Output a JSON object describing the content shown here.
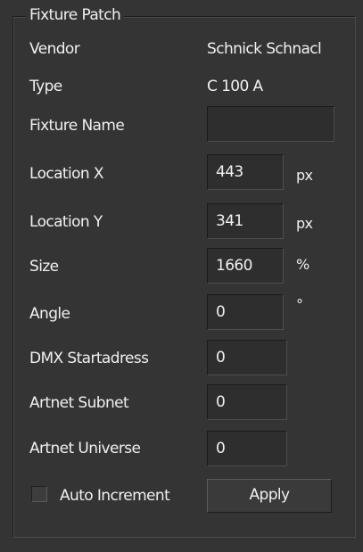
{
  "group": {
    "title": "Fixture Patch"
  },
  "vendor": {
    "label": "Vendor",
    "value": "Schnick Schnacl"
  },
  "type": {
    "label": "Type",
    "value": "C 100 A"
  },
  "fixture_name": {
    "label": "Fixture Name",
    "value": ""
  },
  "location_x": {
    "label": "Location X",
    "value": "443",
    "unit": "px"
  },
  "location_y": {
    "label": "Location Y",
    "value": "341",
    "unit": "px"
  },
  "size": {
    "label": "Size",
    "value": "1660",
    "unit": "%"
  },
  "angle": {
    "label": "Angle",
    "value": "0",
    "unit": "°"
  },
  "dmx_start": {
    "label": "DMX Startadress",
    "value": "0"
  },
  "artnet_subnet": {
    "label": "Artnet Subnet",
    "value": "0"
  },
  "artnet_universe": {
    "label": "Artnet Universe",
    "value": "0"
  },
  "auto_increment": {
    "label": "Auto Increment",
    "checked": false
  },
  "apply_button": {
    "label": "Apply"
  }
}
